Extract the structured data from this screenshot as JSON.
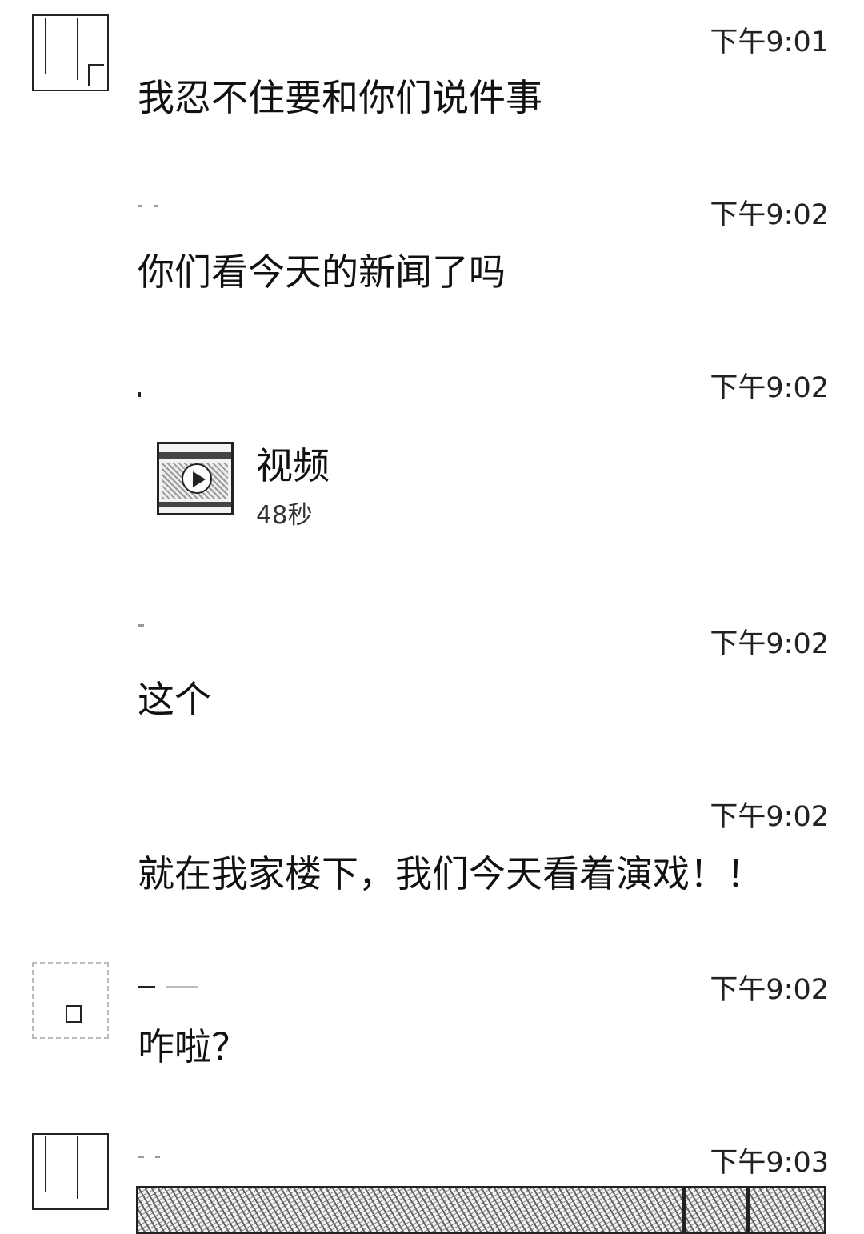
{
  "messages": [
    {
      "time": "下午9:01",
      "text": "我忍不住要和你们说件事"
    },
    {
      "time": "下午9:02",
      "text": "你们看今天的新闻了吗"
    },
    {
      "time": "下午9:02",
      "video": {
        "title": "视频",
        "duration": "48秒"
      }
    },
    {
      "time": "下午9:02",
      "text": "这个"
    },
    {
      "time": "下午9:02",
      "text": "就在我家楼下，我们今天看着演戏！！"
    },
    {
      "time": "下午9:02",
      "text": "咋啦？"
    },
    {
      "time": "下午9:03"
    }
  ],
  "icons": {
    "avatar": "avatar-icon",
    "play": "play-icon"
  }
}
